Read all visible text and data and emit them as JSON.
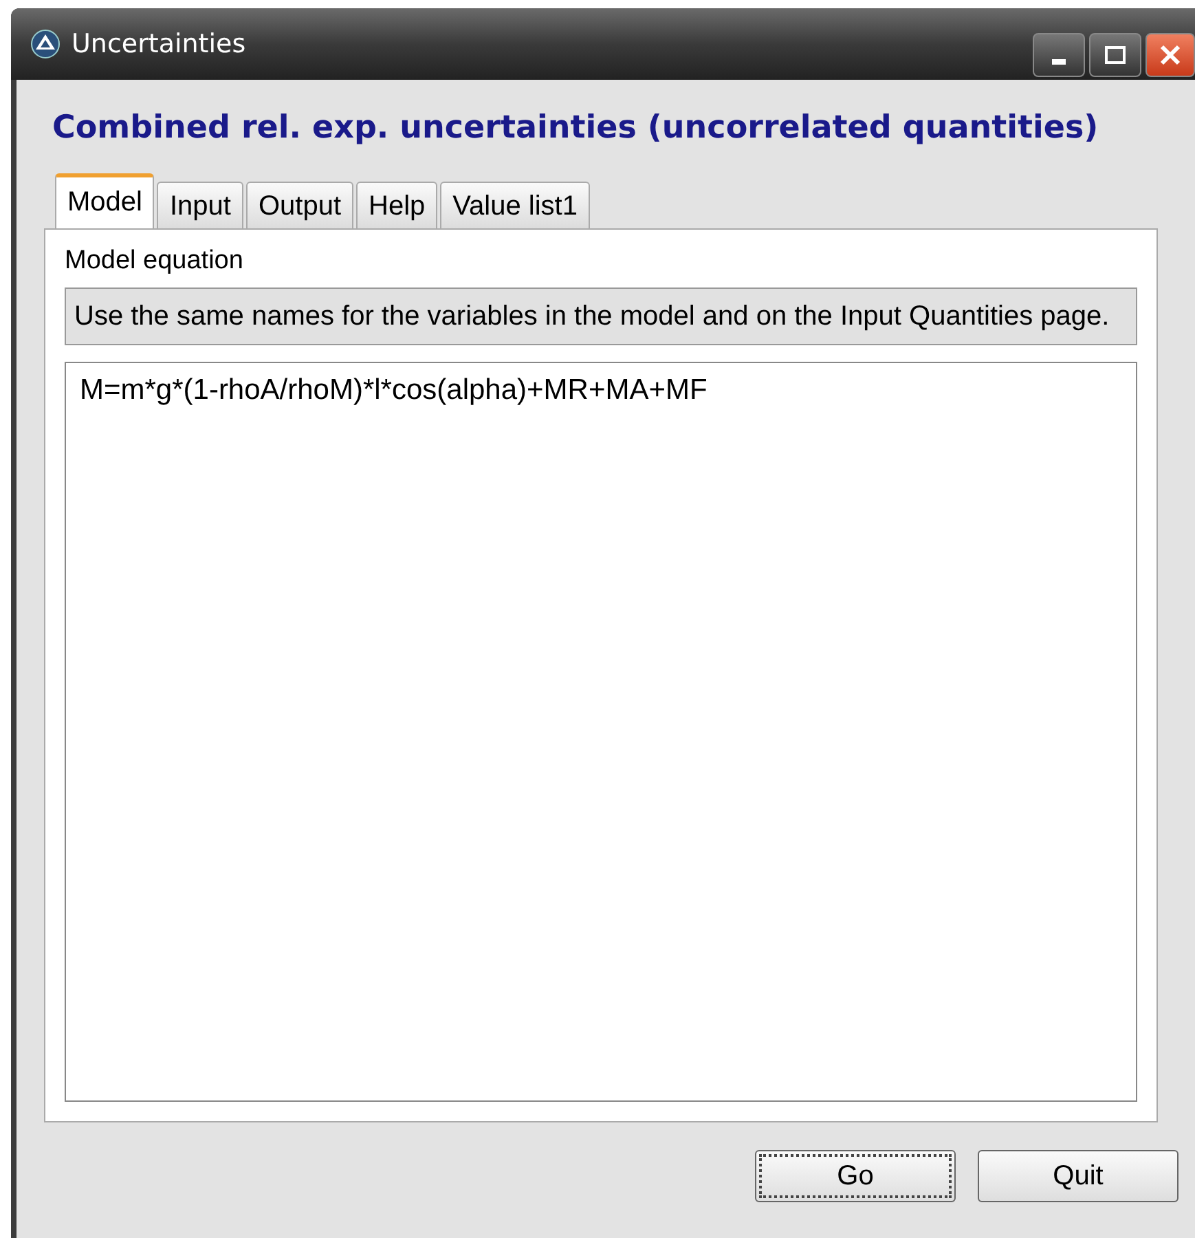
{
  "window": {
    "title": "Uncertainties"
  },
  "heading": "Combined rel. exp. uncertainties (uncorrelated quantities)",
  "tabs": [
    {
      "label": "Model",
      "selected": true
    },
    {
      "label": "Input",
      "selected": false
    },
    {
      "label": "Output",
      "selected": false
    },
    {
      "label": "Help",
      "selected": false
    },
    {
      "label": "Value list1",
      "selected": false
    }
  ],
  "section_label": "Model equation",
  "hint": "Use the same names for the variables in the model and on the Input Quantities page.",
  "equation": "M=m*g*(1-rhoA/rhoM)*l*cos(alpha)+MR+MA+MF",
  "buttons": [
    {
      "label": "Go",
      "focused": true
    },
    {
      "label": "Quit",
      "focused": false
    }
  ]
}
